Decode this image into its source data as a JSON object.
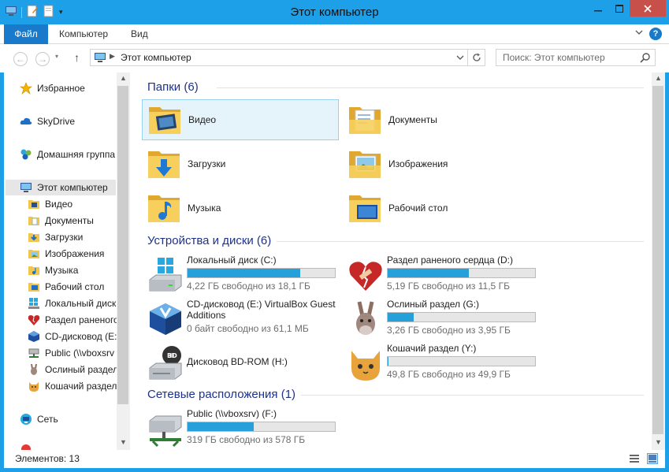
{
  "window": {
    "title": "Этот компьютер",
    "accent": "#1ea0e8"
  },
  "ribbon": {
    "tabs": [
      "Файл",
      "Компьютер",
      "Вид"
    ]
  },
  "address": {
    "path": "Этот компьютер",
    "search_placeholder": "Поиск: Этот компьютер"
  },
  "nav": {
    "favorites": "Избранное",
    "skydrive": "SkyDrive",
    "homegroup": "Домашняя группа",
    "computer": "Этот компьютер",
    "children": [
      "Видео",
      "Документы",
      "Загрузки",
      "Изображения",
      "Музыка",
      "Рабочий стол",
      "Локальный диск",
      "Раздел раненого",
      "CD-дисковод (E:",
      "Public (\\\\vboxsrv",
      "Ослиный раздел",
      "Кошачий раздел"
    ],
    "network": "Сеть"
  },
  "groups": {
    "folders": "Папки (6)",
    "devices": "Устройства и диски (6)",
    "network": "Сетевые расположения (1)"
  },
  "folders": [
    "Видео",
    "Документы",
    "Загрузки",
    "Изображения",
    "Музыка",
    "Рабочий стол"
  ],
  "drives": [
    {
      "name": "Локальный диск (C:)",
      "free": "4,22 ГБ свободно из 18,1 ГБ",
      "used_fraction": 0.767,
      "icon": "windows-drive-icon"
    },
    {
      "name": "Раздел раненого сердца (D:)",
      "free": "5,19 ГБ свободно из 11,5 ГБ",
      "used_fraction": 0.549,
      "icon": "broken-heart-icon"
    },
    {
      "name": "CD-дисковод (E:) VirtualBox Guest Additions",
      "free": "0 байт свободно из 61,1 МБ",
      "icon": "virtualbox-icon"
    },
    {
      "name": "Ослиный раздел (G:)",
      "free": "3,26 ГБ свободно из 3,95 ГБ",
      "used_fraction": 0.175,
      "icon": "donkey-icon"
    },
    {
      "name": "Дисковод BD-ROM (H:)",
      "icon": "bd-drive-icon"
    },
    {
      "name": "Кошачий раздел (Y:)",
      "free": "49,8 ГБ свободно из 49,9 ГБ",
      "used_fraction": 0.002,
      "icon": "cat-icon"
    }
  ],
  "network_drives": [
    {
      "name": "Public (\\\\vboxsrv) (F:)",
      "free": "319 ГБ свободно из 578 ГБ",
      "used_fraction": 0.448,
      "icon": "network-drive-icon"
    }
  ],
  "status": {
    "items": "Элементов: 13"
  }
}
